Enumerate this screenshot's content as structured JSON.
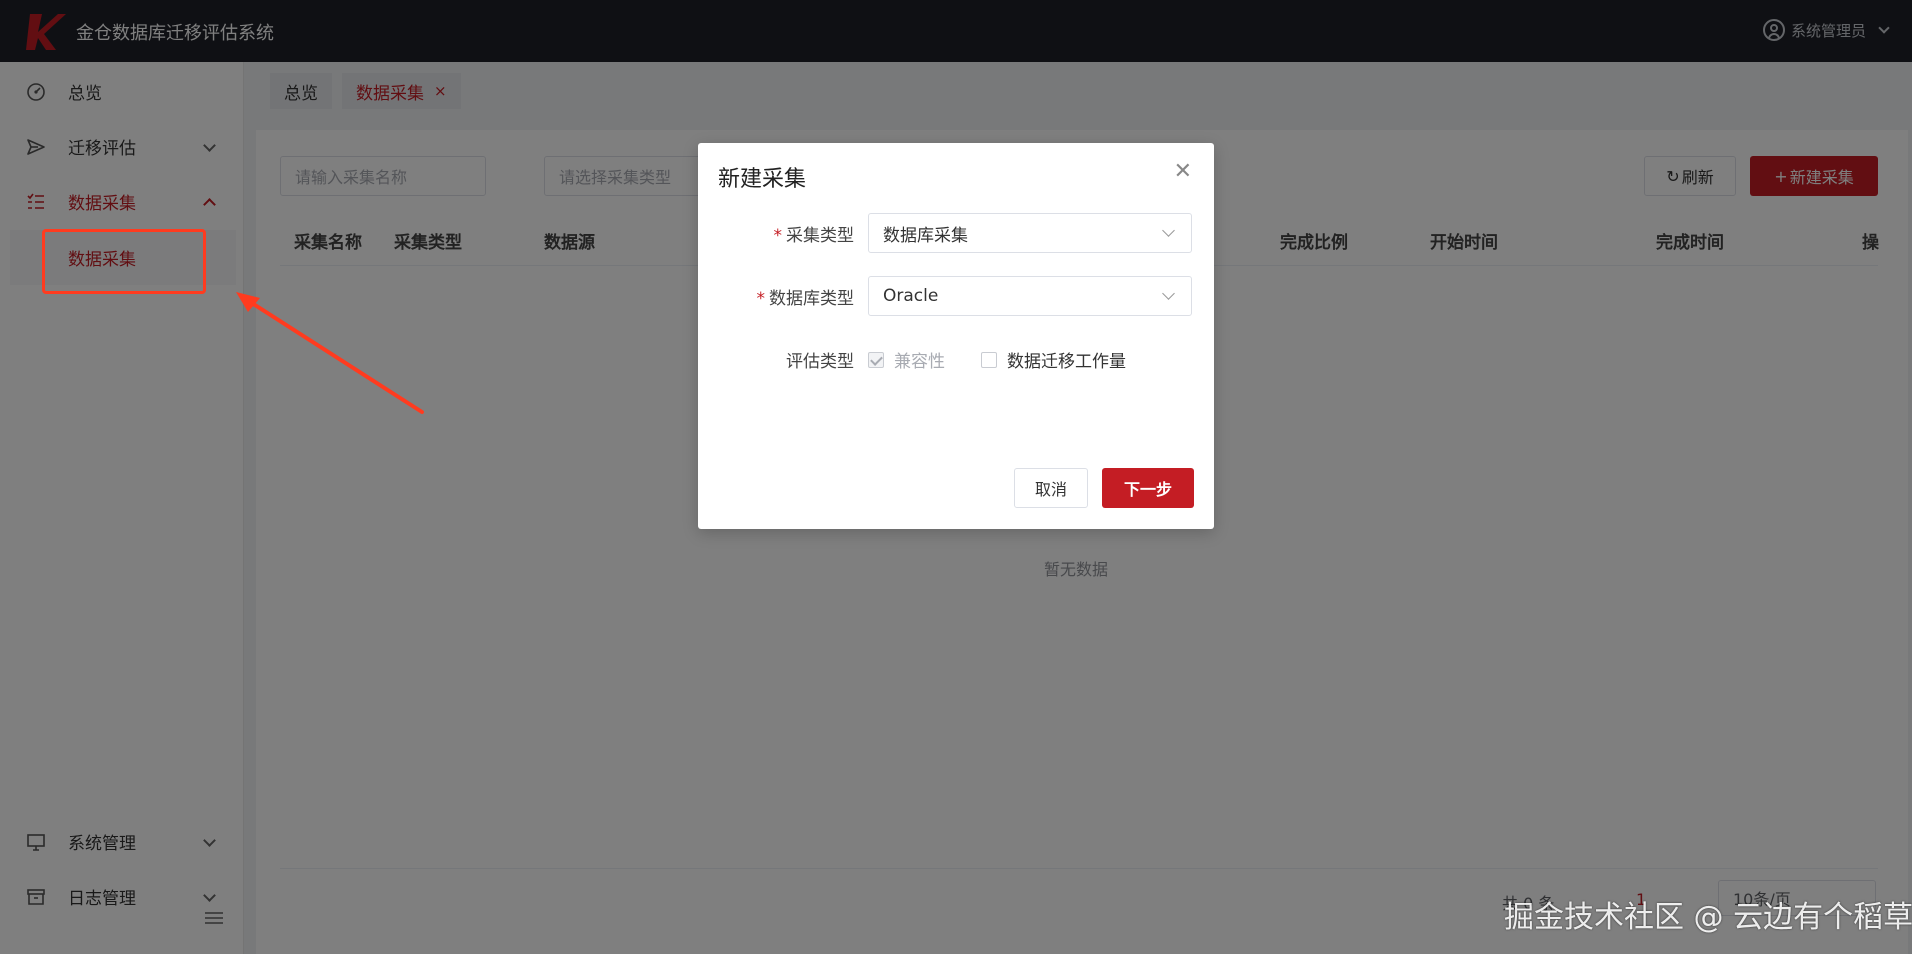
{
  "header": {
    "title": "金仓数据库迁移评估系统",
    "user": "系统管理员"
  },
  "sidebar": {
    "items": [
      {
        "label": "总览",
        "icon": "dashboard-icon"
      },
      {
        "label": "迁移评估",
        "icon": "send-icon"
      },
      {
        "label": "数据采集",
        "icon": "list-icon"
      },
      {
        "label": "系统管理",
        "icon": "monitor-icon"
      },
      {
        "label": "日志管理",
        "icon": "archive-icon"
      }
    ],
    "sub_item": "数据采集"
  },
  "tags": {
    "overview": "总览",
    "collect": "数据采集"
  },
  "toolbar": {
    "search_name_placeholder": "请输入采集名称",
    "search_type_placeholder": "请选择采集类型",
    "refresh_label": "刷新",
    "new_label": "新建采集"
  },
  "table": {
    "columns": [
      "采集名称",
      "采集类型",
      "数据源",
      "完成比例",
      "开始时间",
      "完成时间",
      "操"
    ],
    "empty_text": "暂无数据"
  },
  "pagination": {
    "total": "共 0 条",
    "current": "1",
    "page_size": "10条/页"
  },
  "dialog": {
    "title": "新建采集",
    "collect_type_label": "采集类型",
    "collect_type_value": "数据库采集",
    "db_type_label": "数据库类型",
    "db_type_value": "Oracle",
    "eval_type_label": "评估类型",
    "eval_options": [
      {
        "label": "兼容性",
        "checked": true,
        "disabled": true
      },
      {
        "label": "数据迁移工作量",
        "checked": false,
        "disabled": false
      }
    ],
    "cancel_label": "取消",
    "next_label": "下一步"
  },
  "watermark": "掘金技术社区 @ 云边有个稻草人",
  "colors": {
    "brand": "#c41d24",
    "header_bg": "#1f2129",
    "annotation": "#ff3b1f"
  }
}
